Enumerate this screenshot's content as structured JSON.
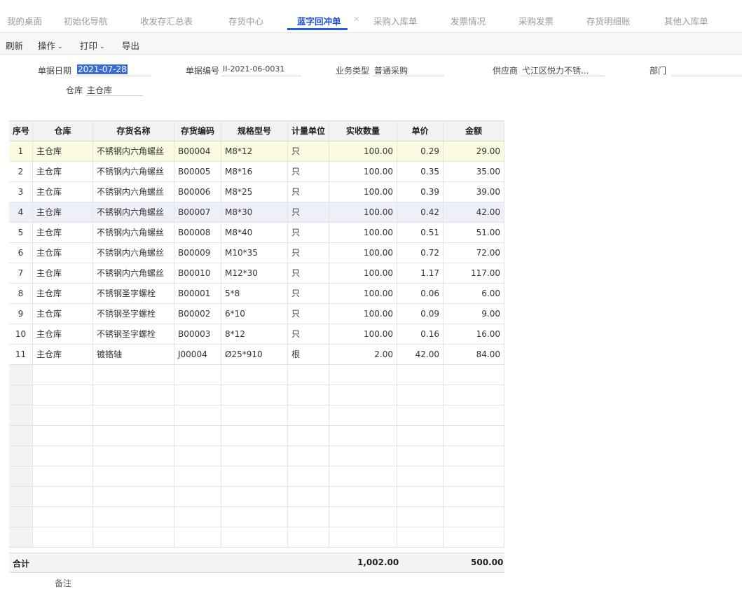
{
  "tabs": [
    {
      "label": "我的桌面"
    },
    {
      "label": "初始化导航"
    },
    {
      "label": "收发存汇总表"
    },
    {
      "label": "存货中心"
    },
    {
      "label": "蓝字回冲单"
    },
    {
      "label": "采购入库单"
    },
    {
      "label": "发票情况"
    },
    {
      "label": "采购发票"
    },
    {
      "label": "存货明细账"
    },
    {
      "label": "其他入库单"
    }
  ],
  "active_tab_index": 4,
  "toolbar": {
    "refresh": "刷新",
    "operate": "操作",
    "print": "打印",
    "export": "导出"
  },
  "form": {
    "date_label": "单据日期",
    "date_value": "2021-07-28",
    "number_label": "单据编号",
    "number_value": "II-2021-06-0031",
    "biz_label": "业务类型",
    "biz_value": "普通采购",
    "supplier_label": "供应商",
    "supplier_value": "弋江区悦力不锈...",
    "dept_label": "部门",
    "dept_value": "",
    "warehouse_label": "仓库",
    "warehouse_value": "主仓库"
  },
  "columns": [
    "序号",
    "仓库",
    "存货名称",
    "存货编码",
    "规格型号",
    "计量单位",
    "实收数量",
    "单价",
    "金额"
  ],
  "rows": [
    {
      "no": "1",
      "wh": "主仓库",
      "name": "不锈钢内六角螺丝",
      "code": "B00004",
      "spec": "M8*12",
      "unit": "只",
      "qty": "100.00",
      "price": "0.29",
      "amount": "29.00"
    },
    {
      "no": "2",
      "wh": "主仓库",
      "name": "不锈钢内六角螺丝",
      "code": "B00005",
      "spec": "M8*16",
      "unit": "只",
      "qty": "100.00",
      "price": "0.35",
      "amount": "35.00"
    },
    {
      "no": "3",
      "wh": "主仓库",
      "name": "不锈钢内六角螺丝",
      "code": "B00006",
      "spec": "M8*25",
      "unit": "只",
      "qty": "100.00",
      "price": "0.39",
      "amount": "39.00"
    },
    {
      "no": "4",
      "wh": "主仓库",
      "name": "不锈钢内六角螺丝",
      "code": "B00007",
      "spec": "M8*30",
      "unit": "只",
      "qty": "100.00",
      "price": "0.42",
      "amount": "42.00"
    },
    {
      "no": "5",
      "wh": "主仓库",
      "name": "不锈钢内六角螺丝",
      "code": "B00008",
      "spec": "M8*40",
      "unit": "只",
      "qty": "100.00",
      "price": "0.51",
      "amount": "51.00"
    },
    {
      "no": "6",
      "wh": "主仓库",
      "name": "不锈钢内六角螺丝",
      "code": "B00009",
      "spec": "M10*35",
      "unit": "只",
      "qty": "100.00",
      "price": "0.72",
      "amount": "72.00"
    },
    {
      "no": "7",
      "wh": "主仓库",
      "name": "不锈钢内六角螺丝",
      "code": "B00010",
      "spec": "M12*30",
      "unit": "只",
      "qty": "100.00",
      "price": "1.17",
      "amount": "117.00"
    },
    {
      "no": "8",
      "wh": "主仓库",
      "name": "不锈钢圣字螺栓",
      "code": "B00001",
      "spec": "5*8",
      "unit": "只",
      "qty": "100.00",
      "price": "0.06",
      "amount": "6.00"
    },
    {
      "no": "9",
      "wh": "主仓库",
      "name": "不锈钢圣字螺栓",
      "code": "B00002",
      "spec": "6*10",
      "unit": "只",
      "qty": "100.00",
      "price": "0.09",
      "amount": "9.00"
    },
    {
      "no": "10",
      "wh": "主仓库",
      "name": "不锈钢圣字螺栓",
      "code": "B00003",
      "spec": "8*12",
      "unit": "只",
      "qty": "100.00",
      "price": "0.16",
      "amount": "16.00"
    },
    {
      "no": "11",
      "wh": "主仓库",
      "name": "镀铬轴",
      "code": "J00004",
      "spec": "Ø25*910",
      "unit": "根",
      "qty": "2.00",
      "price": "42.00",
      "amount": "84.00"
    }
  ],
  "empty_rows": 9,
  "totals": {
    "label": "合计",
    "qty": "1,002.00",
    "amount": "500.00"
  },
  "note_label": "备注",
  "colors": {
    "accent": "#2a5bd7",
    "selected_row": "#fbfbe2",
    "hover_row": "#eef0f9"
  }
}
